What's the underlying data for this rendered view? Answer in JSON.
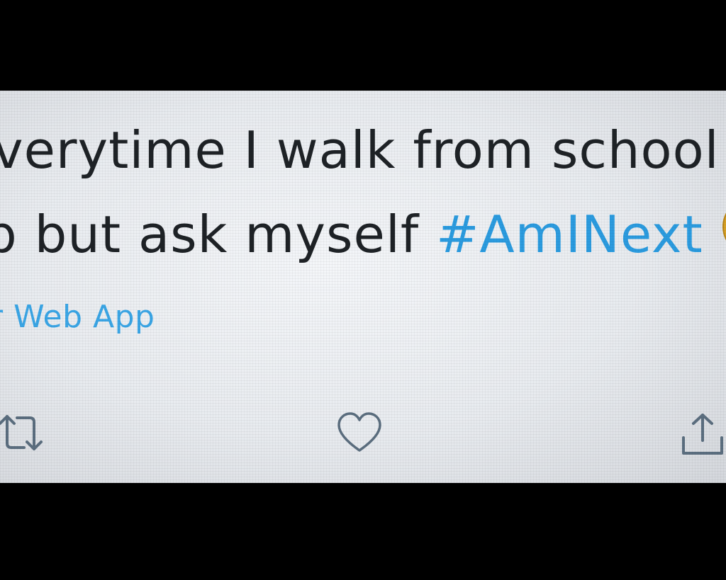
{
  "tweet": {
    "text_line1": "verytime I walk from school to",
    "text_line2_plain": "p but ask myself ",
    "hashtag": "#AmINext",
    "emoji": "weary-face-emoji",
    "source": "r Web App"
  },
  "actions": {
    "retweet_icon": "retweet-icon",
    "like_icon": "heart-icon",
    "share_icon": "share-icon"
  },
  "colors": {
    "text": "#1e2226",
    "link": "#2b9ce0",
    "icon": "#5b6e7f",
    "screen_bg": "#eceff3",
    "letterbox": "#000000"
  }
}
